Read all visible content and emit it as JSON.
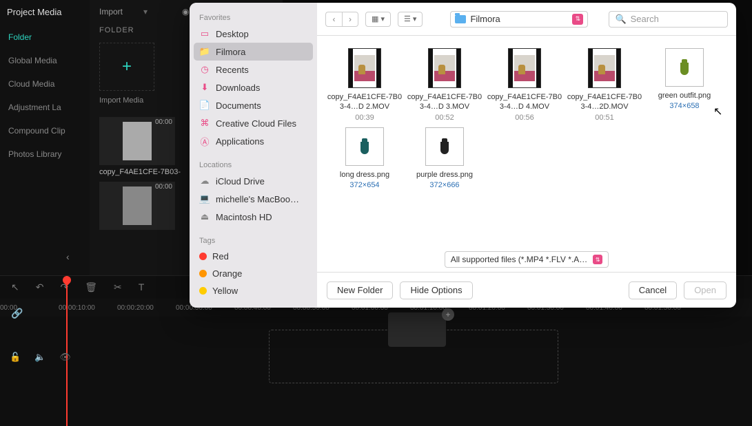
{
  "editor": {
    "title": "Project Media",
    "sidebar": [
      "Folder",
      "Global Media",
      "Cloud Media",
      "Adjustment La",
      "Compound Clip",
      "Photos Library"
    ],
    "active_sidebar": 0,
    "topmenu": {
      "import": "Import",
      "record": "Rec"
    },
    "folder_label": "FOLDER",
    "import_hint": "Import Media",
    "clip": {
      "name": "copy_F4AE1CFE-7B03-",
      "dur1": "00:00",
      "dur2": "00:00"
    },
    "timeline_marks": [
      "00:00",
      "00:00:10:00",
      "00:00:20:00",
      "00:00:30:00",
      "00:00:40:00",
      "00:00:50:00",
      "00:01:00:00",
      "00:01:10:00",
      "00:01:20:00",
      "00:01:30:00",
      "00:01:40:00",
      "00:01:50:00"
    ]
  },
  "finder": {
    "sidebar": {
      "favorites_label": "Favorites",
      "favorites": [
        {
          "icon": "desktop",
          "label": "Desktop"
        },
        {
          "icon": "folder",
          "label": "Filmora",
          "selected": true
        },
        {
          "icon": "clock",
          "label": "Recents"
        },
        {
          "icon": "download",
          "label": "Downloads"
        },
        {
          "icon": "doc",
          "label": "Documents"
        },
        {
          "icon": "cc",
          "label": "Creative Cloud Files"
        },
        {
          "icon": "apps",
          "label": "Applications"
        }
      ],
      "locations_label": "Locations",
      "locations": [
        {
          "icon": "icloud",
          "label": "iCloud Drive"
        },
        {
          "icon": "laptop",
          "label": "michelle's MacBoo…"
        },
        {
          "icon": "disk",
          "label": "Macintosh HD"
        }
      ],
      "tags_label": "Tags",
      "tags": [
        {
          "color": "#ff3b30",
          "label": "Red"
        },
        {
          "color": "#ff9500",
          "label": "Orange"
        },
        {
          "color": "#ffcc00",
          "label": "Yellow"
        }
      ]
    },
    "path": "Filmora",
    "search_placeholder": "Search",
    "files": [
      {
        "kind": "vid",
        "name": "copy_F4AE1CFE-7B03-4…D 2.MOV",
        "meta": "00:39"
      },
      {
        "kind": "vid",
        "name": "copy_F4AE1CFE-7B03-4…D 3.MOV",
        "meta": "00:52"
      },
      {
        "kind": "vid",
        "name": "copy_F4AE1CFE-7B03-4…D 4.MOV",
        "meta": "00:56"
      },
      {
        "kind": "vid",
        "name": "copy_F4AE1CFE-7B03-4…2D.MOV",
        "meta": "00:51"
      },
      {
        "kind": "img",
        "shape": "green",
        "name": "green outfit.png",
        "meta": "374×658"
      },
      {
        "kind": "img",
        "shape": "teal",
        "name": "long dress.png",
        "meta": "372×654"
      },
      {
        "kind": "img",
        "shape": "black",
        "name": "purple dress.png",
        "meta": "372×666"
      }
    ],
    "filter": "All supported files (*.MP4 *.FLV *.A…",
    "buttons": {
      "new_folder": "New Folder",
      "hide_options": "Hide Options",
      "cancel": "Cancel",
      "open": "Open"
    }
  }
}
